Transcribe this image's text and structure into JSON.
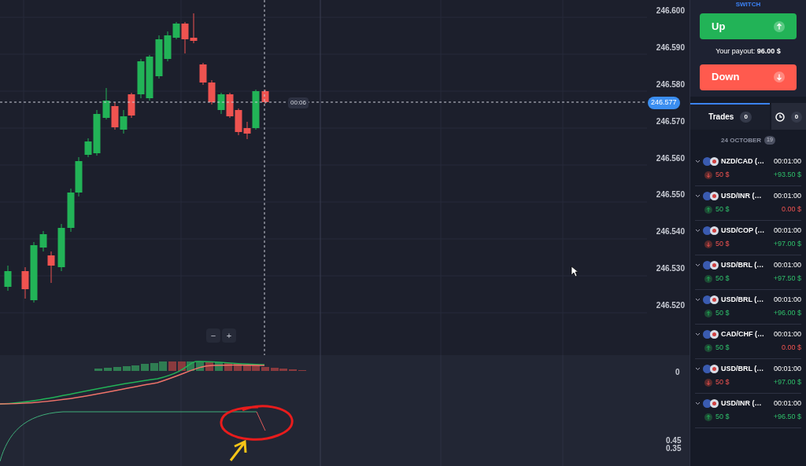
{
  "chart": {
    "price_labels": [
      "246.600",
      "246.590",
      "246.580",
      "246.570",
      "246.560",
      "246.550",
      "246.540",
      "246.530",
      "246.520"
    ],
    "current_price": "246.577",
    "timer": "00:06",
    "zoom_out": "−",
    "zoom_in": "+"
  },
  "indicator": {
    "zero_label": "0",
    "bottom_labels": [
      "0.45",
      "0.35"
    ]
  },
  "sidebar": {
    "switch_label": "SWITCH",
    "up_button": "Up",
    "payout": "Your payout: **96.00 $**",
    "down_button": "Down",
    "tabs": [
      {
        "kind": "trades",
        "label": "Trades",
        "count": "0",
        "selected": true
      },
      {
        "kind": "history",
        "count": "0",
        "selected": false
      }
    ],
    "date": "24 OCTOBER",
    "date_count": "19",
    "trades": [
      {
        "pair": "NZD/CAD (…",
        "duration": "00:01:00",
        "kind": "down",
        "amount": "50 $",
        "result": "+93.50 $",
        "won": true
      },
      {
        "pair": "USD/INR (…",
        "duration": "00:01:00",
        "kind": "up",
        "amount": "50 $",
        "result": "0.00 $",
        "won": false
      },
      {
        "pair": "USD/COP (…",
        "duration": "00:01:00",
        "kind": "down",
        "amount": "50 $",
        "result": "+97.00 $",
        "won": true
      },
      {
        "pair": "USD/BRL (…",
        "duration": "00:01:00",
        "kind": "up",
        "amount": "50 $",
        "result": "+97.50 $",
        "won": true
      },
      {
        "pair": "USD/BRL (…",
        "duration": "00:01:00",
        "kind": "up",
        "amount": "50 $",
        "result": "+96.00 $",
        "won": true
      },
      {
        "pair": "CAD/CHF (…",
        "duration": "00:01:00",
        "kind": "up",
        "amount": "50 $",
        "result": "0.00 $",
        "won": false
      },
      {
        "pair": "USD/BRL (…",
        "duration": "00:01:00",
        "kind": "down",
        "amount": "50 $",
        "result": "+97.00 $",
        "won": true
      },
      {
        "pair": "USD/INR (…",
        "duration": "00:01:00",
        "kind": "up",
        "amount": "50 $",
        "result": "+96.50 $",
        "won": true
      }
    ]
  }
}
